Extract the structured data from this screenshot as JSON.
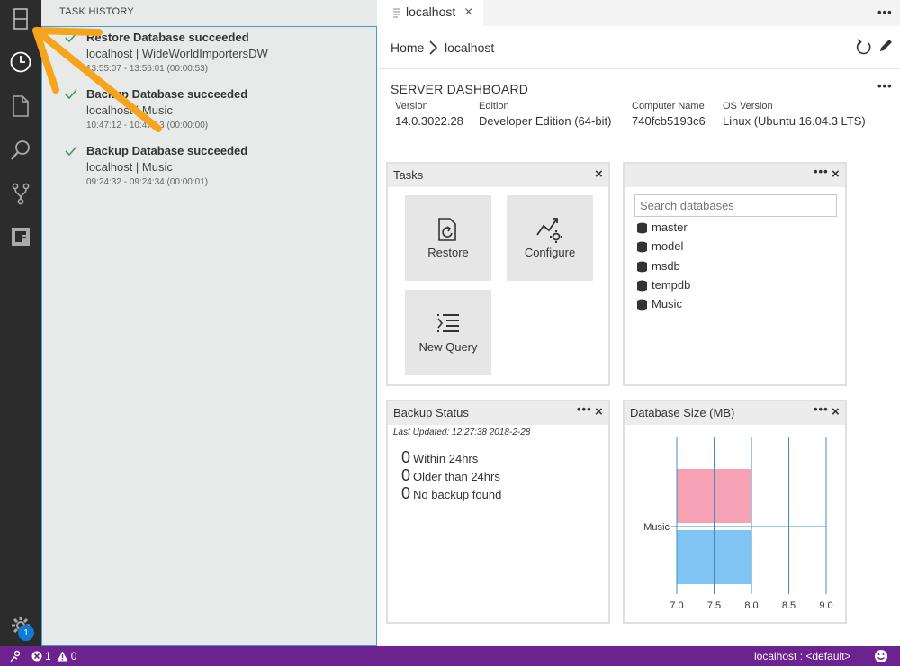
{
  "activity_bar": {
    "icons": [
      "servers-icon",
      "task-history-icon",
      "explorer-icon",
      "search-icon",
      "source-control-icon",
      "extensions-icon",
      "settings-icon"
    ],
    "badge_count": "1"
  },
  "task_history": {
    "header": "TASK HISTORY",
    "items": [
      {
        "title": "Restore Database succeeded",
        "subtitle": "localhost | WideWorldImportersDW",
        "time": "13:55:07 - 13:56:01 (00:00:53)"
      },
      {
        "title": "Backup Database succeeded",
        "subtitle": "localhost | Music",
        "time": "10:47:12 - 10:47:13 (00:00:00)"
      },
      {
        "title": "Backup Database succeeded",
        "subtitle": "localhost | Music",
        "time": "09:24:32 - 09:24:34 (00:00:01)"
      }
    ]
  },
  "editor": {
    "tab_label": "localhost",
    "tab_close": "×",
    "more": "•••",
    "breadcrumb": {
      "home": "Home",
      "current": "localhost"
    }
  },
  "dashboard": {
    "title": "SERVER DASHBOARD",
    "more": "•••",
    "info": [
      {
        "label": "Version",
        "value": "14.0.3022.28"
      },
      {
        "label": "Edition",
        "value": "Developer Edition (64-bit)"
      },
      {
        "label": "Computer Name",
        "value": "740fcb5193c6"
      },
      {
        "label": "OS Version",
        "value": "Linux (Ubuntu 16.04.3 LTS)"
      }
    ]
  },
  "tasks_widget": {
    "title": "Tasks",
    "close": "×",
    "tiles": [
      {
        "label": "Restore",
        "icon": "restore-icon"
      },
      {
        "label": "Configure",
        "icon": "configure-icon"
      },
      {
        "label": "New Query",
        "icon": "new-query-icon"
      }
    ]
  },
  "databases_widget": {
    "more": "•••",
    "close": "×",
    "search_placeholder": "Search databases",
    "databases": [
      "master",
      "model",
      "msdb",
      "tempdb",
      "Music"
    ]
  },
  "backup_widget": {
    "title": "Backup Status",
    "more": "•••",
    "close": "×",
    "last_updated": "Last Updated: 12:27:38 2018-2-28",
    "rows": [
      {
        "count": "0",
        "label": "Within 24hrs"
      },
      {
        "count": "0",
        "label": "Older than 24hrs"
      },
      {
        "count": "0",
        "label": "No backup found"
      }
    ]
  },
  "size_widget": {
    "title": "Database Size (MB)",
    "more": "•••",
    "close": "×"
  },
  "chart_data": {
    "type": "bar",
    "orientation": "horizontal",
    "categories": [
      "Music"
    ],
    "series": [
      {
        "values": [
          8.0
        ],
        "color": "#f7a1b4"
      },
      {
        "values": [
          8.0
        ],
        "color": "#7fc4f2"
      }
    ],
    "xlim": [
      7.0,
      9.0
    ],
    "xticks": [
      "7.0",
      "7.5",
      "8.0",
      "8.5",
      "9.0"
    ],
    "grid": true
  },
  "statusbar": {
    "errors": "1",
    "warnings": "0",
    "connection": "localhost : <default>"
  },
  "colors": {
    "statusbar": "#6c2390",
    "activity_bar": "#2c2c2c",
    "annotation_arrow": "#f5a41c",
    "success_check": "#3c9a5f"
  }
}
